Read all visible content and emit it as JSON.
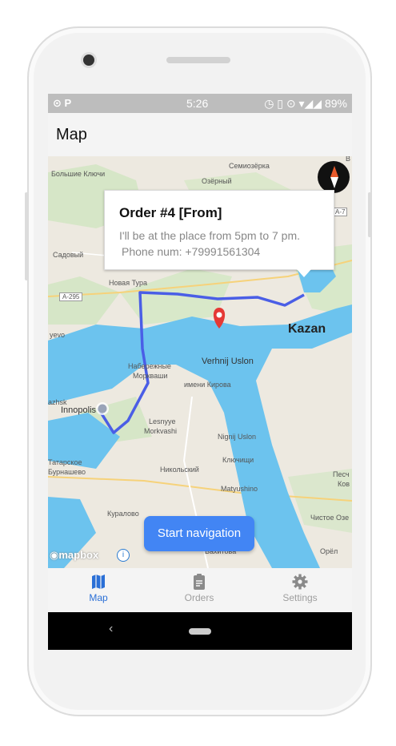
{
  "status_bar": {
    "left_icons": "⊙ P",
    "time": "5:26",
    "right_icons": "◷ ▯ ⊙ ▾◢◢",
    "battery": "89%"
  },
  "app_bar": {
    "title": "Map"
  },
  "map": {
    "places": [
      "Семиозёрка",
      "Большие Ключи",
      "Озёрный",
      "Садовый",
      "Новая Тура",
      "A-295",
      "Kazan",
      "yevo",
      "Набережные",
      "Моркваши",
      "Verhnij Uslon",
      "имени Кирова",
      "azhsk",
      "Innopolis",
      "Lesnyye",
      "Morkvashi",
      "Nignij Uslon",
      "Ключищи",
      "Татарское",
      "Бурнашево",
      "Никольский",
      "Matyushino",
      "Песч",
      "Ков",
      "Куралово",
      "Чистое Озе",
      "Орёл",
      "Вахитова",
      "В",
      "A-7"
    ],
    "attribution": "mapbox",
    "info_symbol": "i"
  },
  "callout": {
    "title": "Order #4 [From]",
    "line1": "I'll be at the place from 5pm to 7 pm.",
    "line2": "Phone num: +79991561304"
  },
  "start_navigation_label": "Start navigation",
  "bottom_nav": {
    "items": [
      {
        "label": "Map",
        "icon": "map-icon",
        "active": true
      },
      {
        "label": "Orders",
        "icon": "clipboard-icon",
        "active": false
      },
      {
        "label": "Settings",
        "icon": "gear-icon",
        "active": false
      }
    ]
  },
  "system_nav": {
    "back_symbol": "‹"
  },
  "colors": {
    "accent": "#4285f4",
    "active_tab": "#2a6fd6",
    "route": "#4a5ee6",
    "water": "#6cc3ee",
    "pin": "#e53935"
  }
}
